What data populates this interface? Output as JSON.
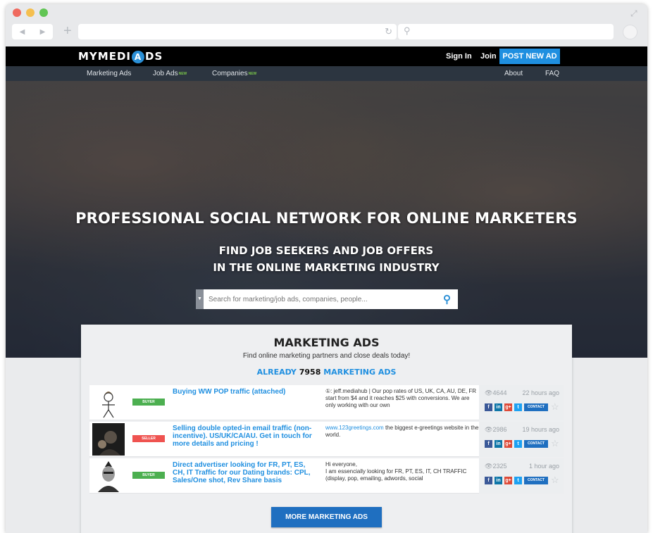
{
  "site": {
    "logo_pre": "MYMEDI",
    "logo_a": "A",
    "logo_post": "DS",
    "signin": "Sign In",
    "join": "Join",
    "post_ad": "POST NEW AD",
    "nav": [
      {
        "label": "Marketing Ads",
        "new": ""
      },
      {
        "label": "Job Ads",
        "new": "NEW"
      },
      {
        "label": "Companies",
        "new": "NEW"
      }
    ],
    "nav_right": [
      "About",
      "FAQ"
    ]
  },
  "hero": {
    "headline": "PROFESSIONAL SOCIAL NETWORK FOR ONLINE MARKETERS",
    "sub1": "FIND JOB SEEKERS AND JOB OFFERS",
    "sub2": "IN THE ONLINE MARKETING INDUSTRY",
    "search_placeholder": "Search for marketing/job ads, companies, people..."
  },
  "panel": {
    "title": "MARKETING ADS",
    "subtitle": "Find online marketing partners and close deals today!",
    "count_pre": "ALREADY",
    "count": "7958",
    "count_post": "MARKETING ADS",
    "more_button": "MORE MARKETING ADS",
    "ads": [
      {
        "badge": "BUYER",
        "title": "Buying WW POP traffic (attached)",
        "desc_link": "",
        "desc": "①: jeff.mediahub | Our pop rates of US, UK, CA, AU, DE, FR start from $4 and it reaches $25 with conversions. We are only working with our own",
        "views": "4644",
        "time": "22 hours ago",
        "contact": "CONTACT"
      },
      {
        "badge": "SELLER",
        "title": "Selling double opted-in email traffic (non-incentive). US/UK/CA/AU. Get in touch for more details and pricing !",
        "desc_link": "www.123greetings.com",
        "desc": " the biggest e-greetings website in the world.",
        "views": "2986",
        "time": "19 hours ago",
        "contact": "CONTACT"
      },
      {
        "badge": "BUYER",
        "title": "Direct advertiser looking for FR, PT, ES, CH, IT Traffic for our Dating brands: CPL, Sales/One shot, Rev Share basis",
        "desc_link": "",
        "desc": "Hi everyone,\nI am essencially looking for FR, PT, ES, IT, CH TRAFFIC (display, pop, emailing, adwords, social",
        "views": "2325",
        "time": "1 hour ago",
        "contact": "CONTACT"
      }
    ]
  },
  "colors": {
    "accent": "#1f8fe0",
    "topbar": "#000000",
    "subnav": "#2c3540",
    "buyer": "#4caf50",
    "seller": "#ef5350"
  }
}
